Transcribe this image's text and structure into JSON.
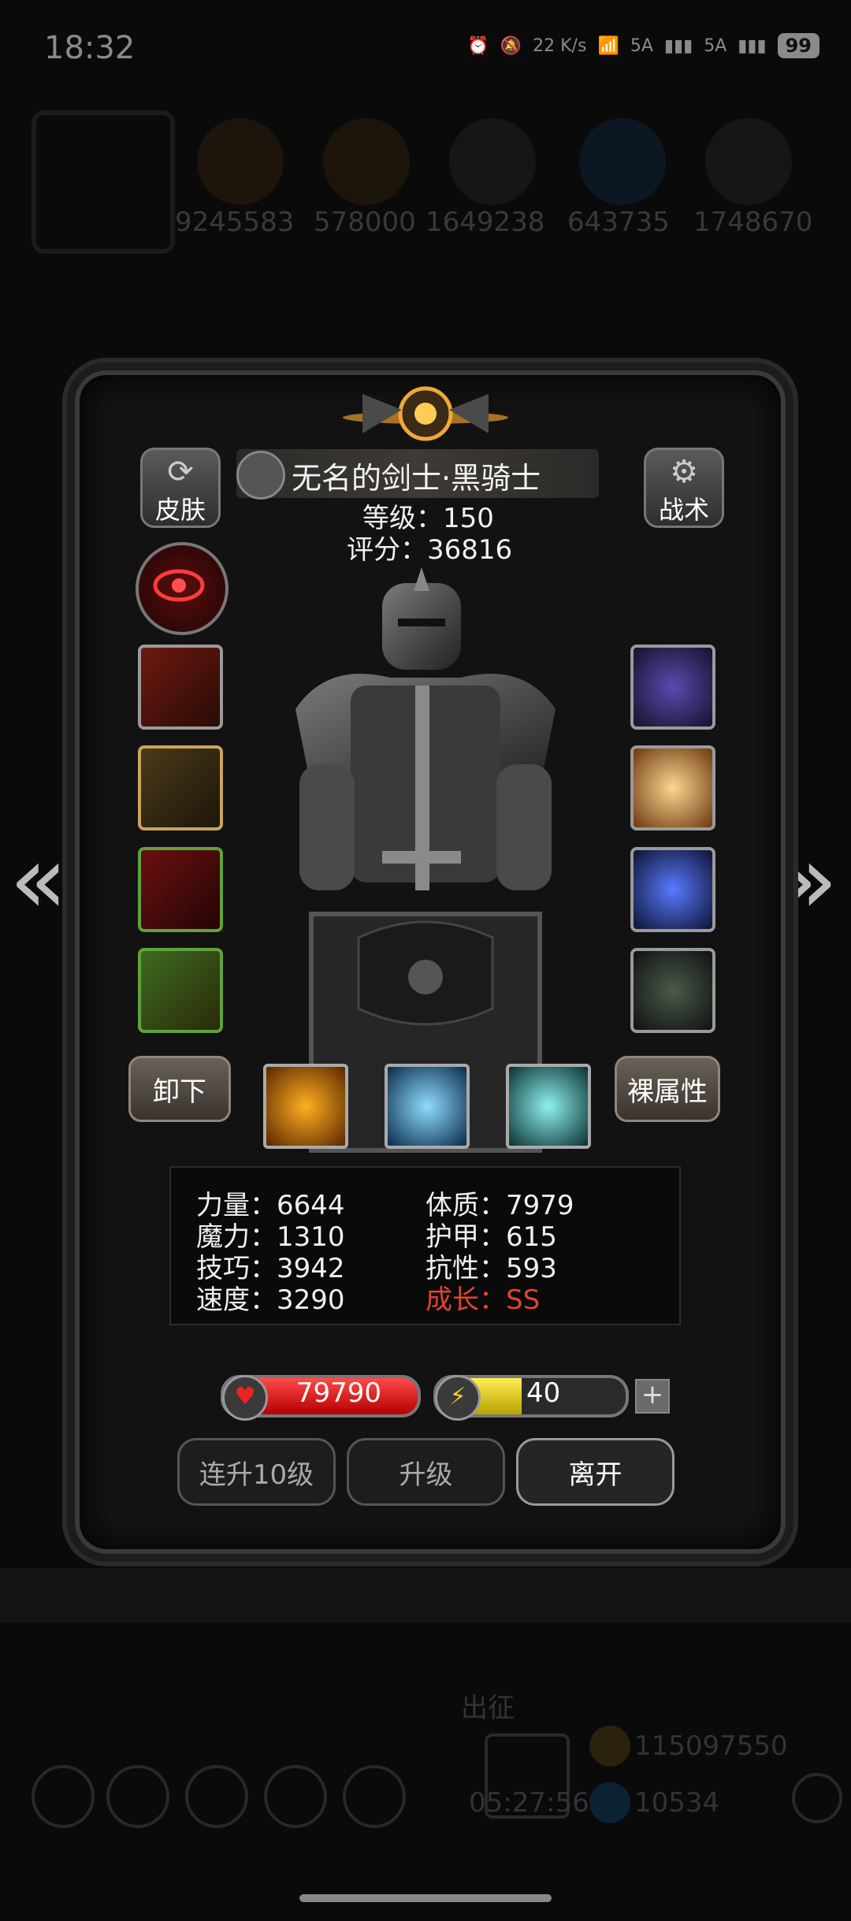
{
  "status_bar": {
    "time": "18:32",
    "net_speed": "22 K/s",
    "signal1": "5A",
    "signal2": "5A",
    "battery": "99"
  },
  "resources": [
    "9245583",
    "578000",
    "1649238",
    "643735",
    "1748670"
  ],
  "hero": {
    "name": "无名的剑士·黑骑士",
    "level_text": "等级：150",
    "score_text": "评分：36816"
  },
  "buttons": {
    "skin": "皮肤",
    "tactics": "战术",
    "unequip": "卸下",
    "naked_attr": "裸属性"
  },
  "stats": {
    "strength": "力量：6644",
    "constitution": "体质：7979",
    "magic": "魔力：1310",
    "armor": "护甲：615",
    "skill": "技巧：3942",
    "resistance": "抗性：593",
    "speed": "速度：3290",
    "growth": "成长：SS"
  },
  "hp": {
    "value": "79790"
  },
  "energy": {
    "value": "40",
    "fill": 0.45
  },
  "actions": {
    "level10": "连升10级",
    "levelup": "升级",
    "leave": "离开"
  },
  "background": {
    "expedition": "出征",
    "timer": "05:27:56",
    "gold": "115097550",
    "gems": "10534"
  },
  "colors": {
    "accent_red": "#e0442e",
    "hp": "#d41010",
    "energy": "#e6d330"
  }
}
